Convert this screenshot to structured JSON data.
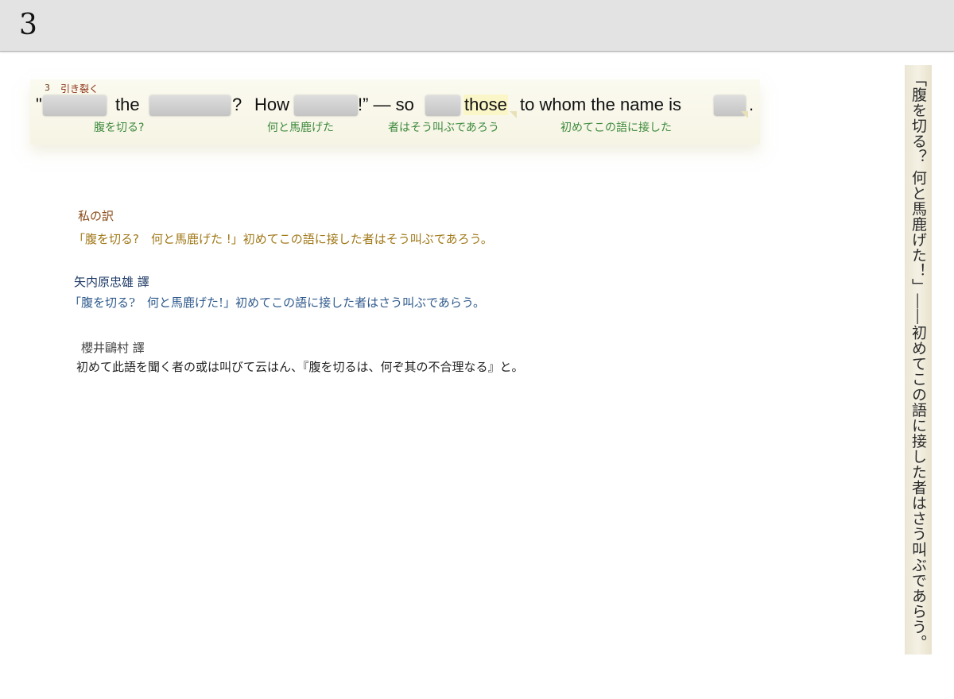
{
  "page": {
    "number": "3"
  },
  "header_note": {
    "number": "3",
    "label": "引き裂く"
  },
  "english": {
    "open_quote": "\"",
    "the": "the",
    "qmark": "?",
    "how": "How",
    "exclaim": "!” — so",
    "those": "those",
    "to_whom": "to whom the name is",
    "period": "."
  },
  "glosses": [
    "腹を切る?",
    "何と馬鹿げた",
    "者はそう叫ぶであろう",
    "初めてこの語に接した"
  ],
  "translations": [
    {
      "label": "私の訳",
      "text": "「腹を切る?　何と馬鹿げた !」初めてこの語に接した者はそう叫ぶであろう。"
    },
    {
      "label": "矢内原忠雄 譯",
      "text": "「腹を切る?　何と馬鹿げた!」初めてこの語に接した者はさう叫ぶであらう。"
    },
    {
      "label": "櫻井鷗村 譯",
      "text": "初めて此語を聞く者の或は叫びて云はん、『腹を切るは、何ぞ其の不合理なる』と。"
    }
  ],
  "vertical_excerpt": "「腹を切る？ 何と馬鹿げた！」――初めてこの語に接した者はさう叫ぶであらう。",
  "colors": {
    "my_translation": "#a07818",
    "my_label": "#8a4a16",
    "yanaihara": "#2f5a8c",
    "yanaihara_label": "#1e3a66",
    "sakurai": "#222222",
    "gloss": "#3d8a3d"
  }
}
